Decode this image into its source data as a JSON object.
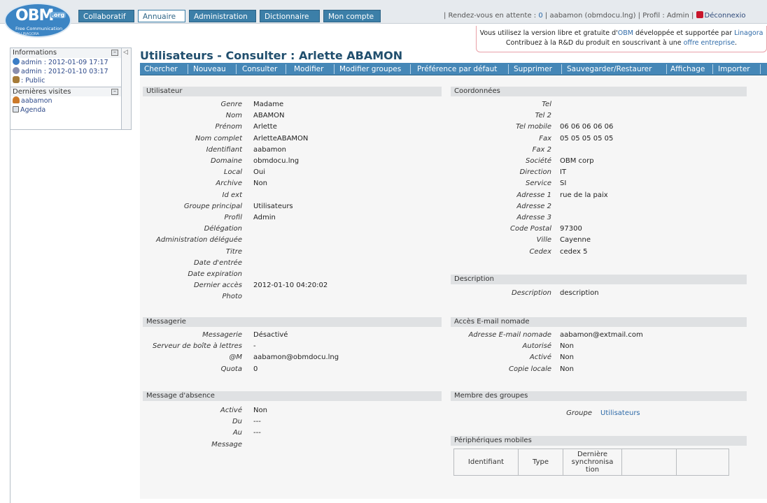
{
  "logo": {
    "big": "OBM",
    "org": ".org",
    "tagline": "Free Communication",
    "by": "BY LINAGORA"
  },
  "nav": {
    "items": [
      "Collaboratif",
      "Annuaire",
      "Administration",
      "Dictionnaire",
      "Mon compte"
    ],
    "active": "Annuaire"
  },
  "status": {
    "rdv_label": "| Rendez-vous en attente :",
    "rdv_count": "0",
    "user": "| aabamon (obmdocu.lng) |",
    "profile": "Profil : Admin |",
    "logout": "Déconnexio"
  },
  "banner": {
    "line1_a": "Vous utilisez la version libre et gratuite d'",
    "line1_link": "OBM",
    "line1_b": " développée et supportée par ",
    "line1_link2": "Linagora",
    "line2_a": "Contribuez à la R&D du produit en souscrivant à une ",
    "line2_link": "offre entreprise",
    "line2_b": "."
  },
  "sidebar": {
    "info_title": "Informations",
    "info_rows": [
      {
        "icon": "clock-icon",
        "text": "admin : 2012-01-09 17:17"
      },
      {
        "icon": "edit-icon",
        "text": "admin : 2012-01-10 03:17"
      },
      {
        "icon": "group-icon",
        "text": ": Public"
      }
    ],
    "visits_title": "Dernières visites",
    "visits": [
      {
        "icon": "user-icon",
        "text": "aabamon"
      },
      {
        "icon": "calendar-icon",
        "text": "Agenda"
      }
    ]
  },
  "page": {
    "title": "Utilisateurs - Consulter : Arlette ABAMON"
  },
  "actions": [
    "Chercher",
    "Nouveau",
    "Consulter",
    "Modifier",
    "Modifier groupes",
    "Préférence par défaut",
    "Supprimer",
    "Sauvegarder/Restaurer",
    "Affichage",
    "Importer"
  ],
  "sections": {
    "utilisateur": "Utilisateur",
    "coordonnees": "Coordonnées",
    "description": "Description",
    "messagerie": "Messagerie",
    "acces_email": "Accès E-mail nomade",
    "absence": "Message d'absence",
    "membre": "Membre des groupes",
    "mobiles": "Périphériques mobiles"
  },
  "user_fields": [
    {
      "label": "Genre",
      "value": "Madame"
    },
    {
      "label": "Nom",
      "value": "ABAMON"
    },
    {
      "label": "Prénom",
      "value": "Arlette"
    },
    {
      "label": "Nom complet",
      "value": "ArletteABAMON"
    },
    {
      "label": "Identifiant",
      "value": "aabamon"
    },
    {
      "label": "Domaine",
      "value": "obmdocu.lng"
    },
    {
      "label": "Local",
      "value": "Oui"
    },
    {
      "label": "Archive",
      "value": "Non"
    },
    {
      "label": "Id ext",
      "value": ""
    },
    {
      "label": "Groupe principal",
      "value": "Utilisateurs"
    },
    {
      "label": "Profil",
      "value": "Admin"
    },
    {
      "label": "Délégation",
      "value": ""
    },
    {
      "label": "Administration déléguée",
      "value": ""
    },
    {
      "label": "Titre",
      "value": ""
    },
    {
      "label": "Date d'entrée",
      "value": ""
    },
    {
      "label": "Date expiration",
      "value": ""
    },
    {
      "label": "Dernier accès",
      "value": "2012-01-10 04:20:02"
    },
    {
      "label": "Photo",
      "value": ""
    }
  ],
  "coord_fields": [
    {
      "label": "Tel",
      "value": ""
    },
    {
      "label": "Tel 2",
      "value": ""
    },
    {
      "label": "Tel mobile",
      "value": "06 06 06 06 06"
    },
    {
      "label": "Fax",
      "value": "05 05 05 05 05"
    },
    {
      "label": "Fax 2",
      "value": ""
    },
    {
      "label": "Société",
      "value": "OBM corp"
    },
    {
      "label": "Direction",
      "value": "IT"
    },
    {
      "label": "Service",
      "value": "SI"
    },
    {
      "label": "Adresse 1",
      "value": "rue de la paix"
    },
    {
      "label": "Adresse 2",
      "value": ""
    },
    {
      "label": "Adresse 3",
      "value": ""
    },
    {
      "label": "Code Postal",
      "value": "97300"
    },
    {
      "label": "Ville",
      "value": "Cayenne"
    },
    {
      "label": "Cedex",
      "value": "cedex 5"
    }
  ],
  "description_field": {
    "label": "Description",
    "value": "description"
  },
  "mail_fields": [
    {
      "label": "Messagerie",
      "value": "Désactivé"
    },
    {
      "label": "Serveur de boîte à lettres",
      "value": "-"
    },
    {
      "label": "@M",
      "value": "aabamon@obmdocu.lng"
    },
    {
      "label": "Quota",
      "value": "0"
    }
  ],
  "nomade_fields": [
    {
      "label": "Adresse E-mail nomade",
      "value": "aabamon@extmail.com"
    },
    {
      "label": "Autorisé",
      "value": "Non"
    },
    {
      "label": "Activé",
      "value": "Non"
    },
    {
      "label": "Copie locale",
      "value": "Non"
    }
  ],
  "absence_fields": [
    {
      "label": "Activé",
      "value": "Non"
    },
    {
      "label": "Du",
      "value": "---"
    },
    {
      "label": "Au",
      "value": "---"
    },
    {
      "label": "Message",
      "value": ""
    }
  ],
  "groups": {
    "label": "Groupe",
    "value": "Utilisateurs"
  },
  "mobile_table": {
    "headers": [
      "Identifiant",
      "Type",
      "Dernière synchronisa tion",
      "",
      ""
    ]
  }
}
